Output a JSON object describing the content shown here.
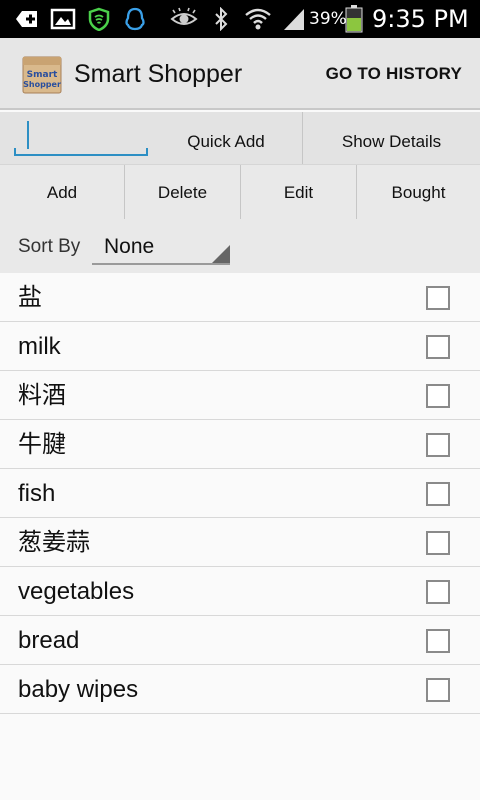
{
  "status_bar": {
    "battery": "39%",
    "time": "9:35 PM",
    "icons": [
      "add-box-icon",
      "image-icon",
      "shield-icon",
      "qq-icon",
      "eye-icon",
      "bluetooth-icon",
      "wifi-icon",
      "signal-icon",
      "battery-icon"
    ]
  },
  "app_bar": {
    "title": "Smart Shopper",
    "app_icon_text": [
      "Smart",
      "Shopper"
    ],
    "history_button": "GO TO HISTORY"
  },
  "quick_add": {
    "input_value": "",
    "quick_add_label": "Quick Add",
    "show_details_label": "Show Details"
  },
  "actions": [
    {
      "label": "Add"
    },
    {
      "label": "Delete"
    },
    {
      "label": "Edit"
    },
    {
      "label": "Bought"
    }
  ],
  "sort": {
    "label": "Sort By",
    "selected": "None"
  },
  "items": [
    {
      "name": "盐",
      "checked": false
    },
    {
      "name": "milk",
      "checked": false
    },
    {
      "name": "料酒",
      "checked": false
    },
    {
      "name": "牛腱",
      "checked": false
    },
    {
      "name": "fish",
      "checked": false
    },
    {
      "name": "葱姜蒜",
      "checked": false
    },
    {
      "name": "vegetables",
      "checked": false
    },
    {
      "name": "bread",
      "checked": false
    },
    {
      "name": "baby wipes",
      "checked": false
    }
  ],
  "colors": {
    "accent": "#2d8fc4",
    "battery_fill": "#8cc63f"
  }
}
